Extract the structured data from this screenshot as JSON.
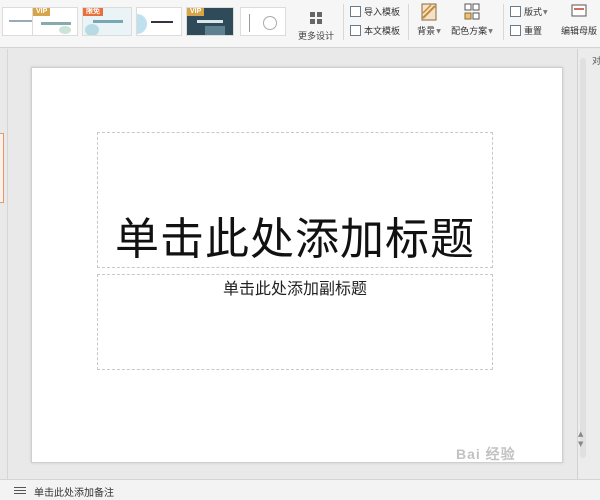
{
  "ribbon": {
    "templates": [
      {
        "badge": ""
      },
      {
        "badge": "VIP"
      },
      {
        "badge": "限免"
      },
      {
        "badge": ""
      },
      {
        "badge": "VIP"
      },
      {
        "badge": ""
      }
    ],
    "more_design_label": "更多设计",
    "import_template_label": "导入模板",
    "this_template_label": "本文模板",
    "background_label": "背景",
    "color_scheme_label": "配色方案",
    "layout_label": "版式",
    "reset_label": "重置",
    "edit_master_label": "编辑母版"
  },
  "slide": {
    "title_placeholder": "单击此处添加标题",
    "subtitle_placeholder": "单击此处添加副标题"
  },
  "notes": {
    "placeholder": "单击此处添加备注"
  },
  "right_panel": {
    "corner_char": "对"
  },
  "watermark": "Bai 经验",
  "colors": {
    "accent_orange": "#e39a6b",
    "vip_gold": "#d7a44a",
    "badge_red": "#e8703a"
  }
}
